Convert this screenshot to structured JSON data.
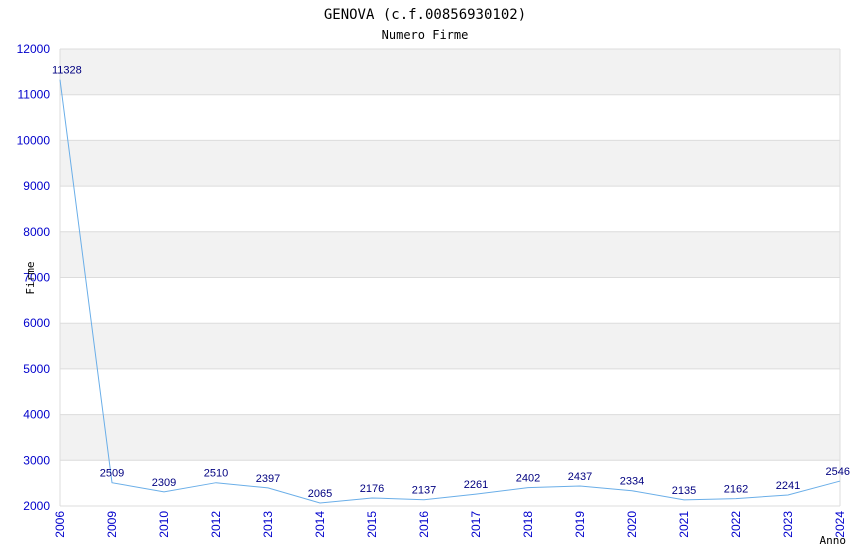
{
  "chart_data": {
    "type": "line",
    "title": "GENOVA (c.f.00856930102)",
    "subtitle": "Numero Firme",
    "xlabel": "Anno",
    "ylabel": "Firme",
    "categories": [
      "2006",
      "2009",
      "2010",
      "2012",
      "2013",
      "2014",
      "2015",
      "2016",
      "2017",
      "2018",
      "2019",
      "2020",
      "2021",
      "2022",
      "2023",
      "2024"
    ],
    "series": [
      {
        "values": [
          11328,
          2509,
          2309,
          2510,
          2397,
          2065,
          2176,
          2137,
          2261,
          2402,
          2437,
          2334,
          2135,
          2162,
          2241,
          2546
        ]
      }
    ],
    "ylim": [
      2000,
      12000
    ],
    "yticks": [
      2000,
      3000,
      4000,
      5000,
      6000,
      7000,
      8000,
      9000,
      10000,
      11000,
      12000
    ],
    "grid": true,
    "legend": "none",
    "colors": {
      "line": "#6aaee8",
      "tick_text": "#0000cc",
      "data_label": "#000080",
      "band": "#f2f2f2",
      "grid": "#dcdcdc"
    }
  }
}
